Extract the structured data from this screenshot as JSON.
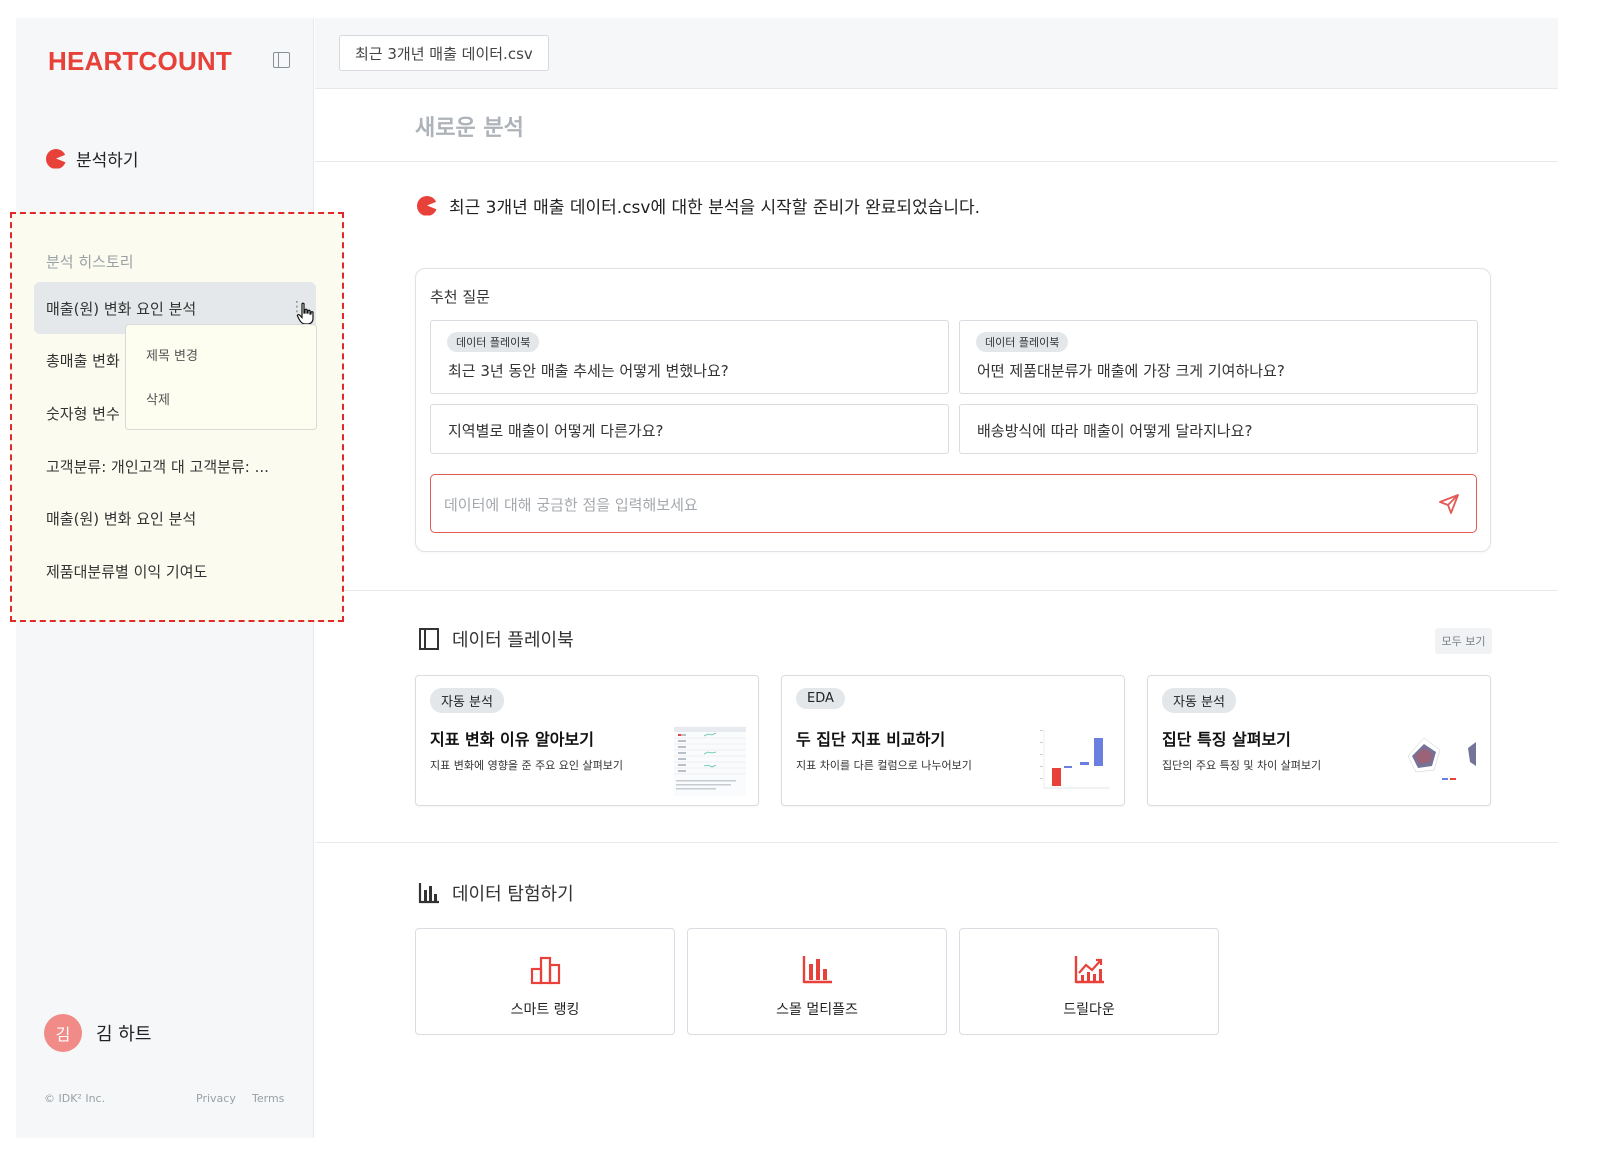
{
  "sidebar": {
    "logo": "HEARTCOUNT",
    "analyze_label": "분석하기",
    "history_title": "분석 히스토리",
    "history_items": [
      {
        "label": "매출(원) 변화 요인 분석"
      },
      {
        "label": "총매출 변화"
      },
      {
        "label": "숫자형 변수"
      },
      {
        "label": "고객분류: 개인고객 대 고객분류: ..."
      },
      {
        "label": "매출(원) 변화 요인 분석"
      },
      {
        "label": "제품대분류별 이익 기여도"
      }
    ],
    "context_menu": [
      "제목 변경",
      "삭제"
    ],
    "user": {
      "avatar_char": "김",
      "name": "김 하트"
    },
    "footer": {
      "copyright": "© IDK² Inc.",
      "privacy": "Privacy",
      "terms": "Terms"
    }
  },
  "topbar": {
    "file_tab": "최근 3개년 매출 데이터.csv"
  },
  "main": {
    "page_title": "새로운 분석",
    "ready_message": "최근 3개년 매출 데이터.csv에 대한 분석을 시작할 준비가 완료되었습니다.",
    "suggest": {
      "title": "추천 질문",
      "questions": [
        {
          "badge": "데이터 플레이북",
          "text": "최근 3년 동안 매출 추세는 어떻게 변했나요?"
        },
        {
          "badge": "데이터 플레이북",
          "text": "어떤 제품대분류가 매출에 가장 크게 기여하나요?"
        },
        {
          "badge": "",
          "text": "지역별로 매출이 어떻게 다른가요?"
        },
        {
          "badge": "",
          "text": "배송방식에 따라 매출이 어떻게 달라지나요?"
        }
      ],
      "input_placeholder": "데이터에 대해 궁금한 점을 입력해보세요"
    },
    "playbook": {
      "title": "데이터 플레이북",
      "view_all": "모두 보기",
      "cards": [
        {
          "badge": "자동 분석",
          "title": "지표 변화 이유 알아보기",
          "desc": "지표 변화에 영향을 준 주요 요인 살펴보기"
        },
        {
          "badge": "EDA",
          "title": "두 집단 지표 비교하기",
          "desc": "지표 차이를 다른 컬럼으로 나누어보기"
        },
        {
          "badge": "자동 분석",
          "title": "집단 특징 살펴보기",
          "desc": "집단의 주요 특징 및 차이 살펴보기"
        }
      ]
    },
    "explore": {
      "title": "데이터 탐험하기",
      "cards": [
        {
          "label": "스마트 랭킹",
          "icon": "smart-ranking-icon"
        },
        {
          "label": "스몰 멀티플즈",
          "icon": "small-multiples-icon"
        },
        {
          "label": "드릴다운",
          "icon": "drilldown-icon"
        }
      ]
    }
  },
  "colors": {
    "brand": "#e8413a",
    "highlight_border": "#e02a2a",
    "badge_bg": "#e3e7ea"
  }
}
